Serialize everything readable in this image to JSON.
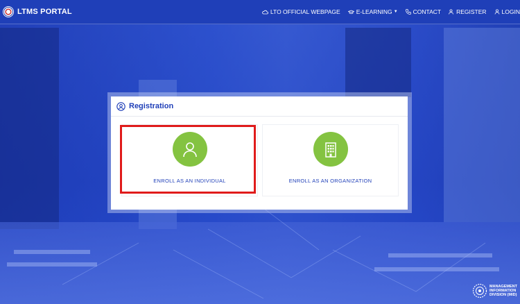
{
  "header": {
    "brand": "LTMS PORTAL",
    "nav": [
      {
        "label": "LTO OFFICIAL WEBPAGE",
        "icon": "cloud-icon"
      },
      {
        "label": "E-LEARNING",
        "icon": "graduation-cap-icon"
      },
      {
        "label": "CONTACT",
        "icon": "phone-icon"
      },
      {
        "label": "REGISTER",
        "icon": "user-plus-icon"
      },
      {
        "label": "LOGIN",
        "icon": "user-icon"
      }
    ]
  },
  "registration": {
    "title": "Registration",
    "options": [
      {
        "label": "ENROLL AS AN INDIVIDUAL",
        "icon": "person-icon"
      },
      {
        "label": "ENROLL AS AN ORGANIZATION",
        "icon": "building-icon"
      }
    ]
  },
  "footer_logo": {
    "line1": "MANAGEMENT",
    "line2": "INFORMATION",
    "line3": "DIVISION",
    "abbr": "(MID)"
  },
  "colors": {
    "primary": "#1f3fb8",
    "accent_green": "#84c341",
    "highlight_red": "#e01b1b"
  }
}
